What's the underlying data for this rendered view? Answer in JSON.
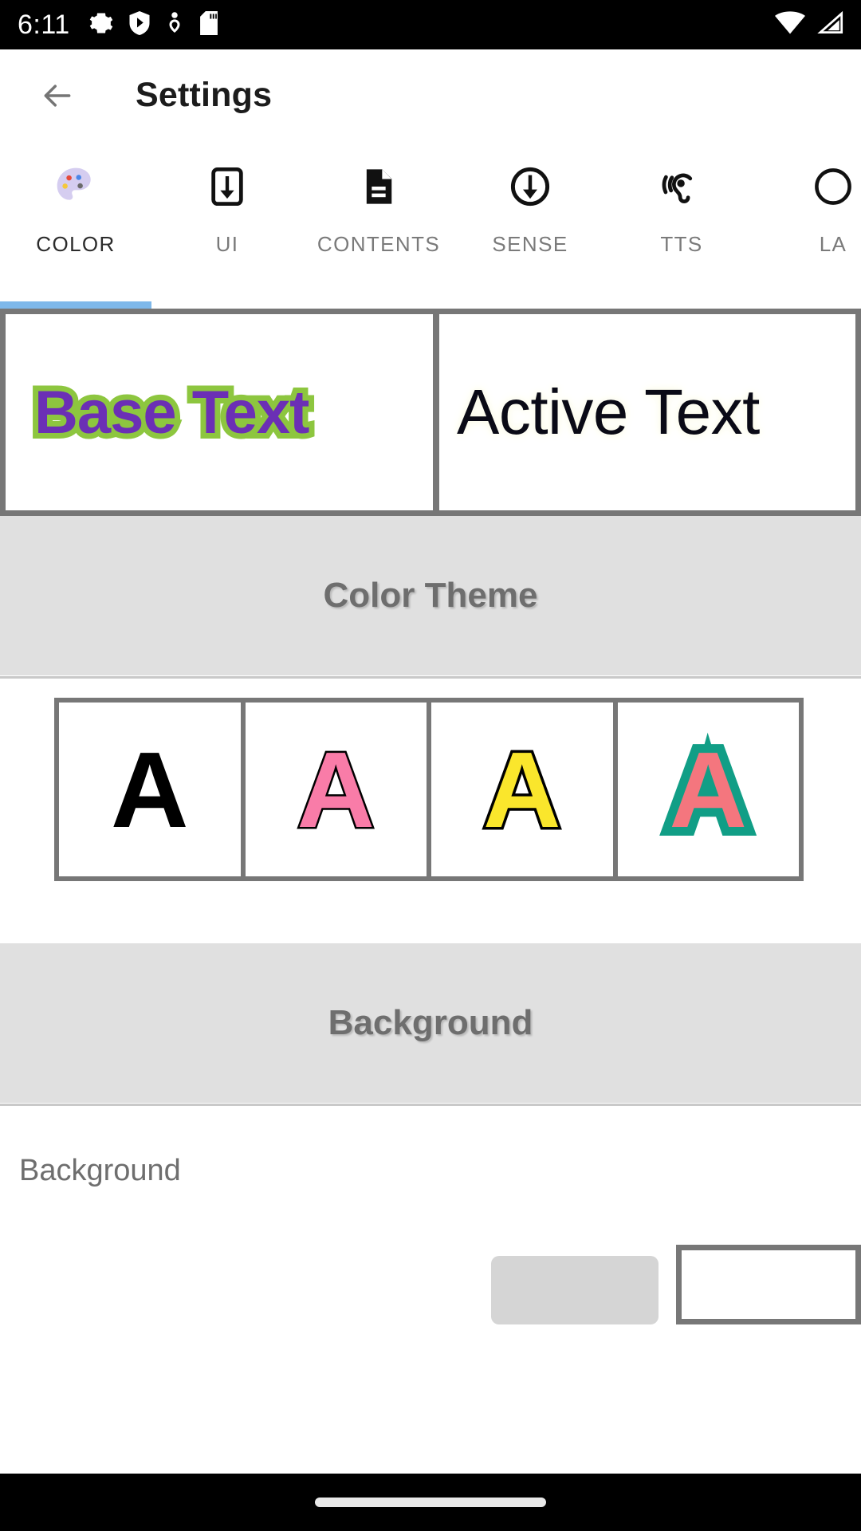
{
  "status_bar": {
    "time": "6:11",
    "left_icons": [
      "gear-icon",
      "shield-play-icon",
      "heart-pulse-icon",
      "sd-card-icon"
    ],
    "right_icons": [
      "wifi-icon",
      "cell-signal-icon"
    ]
  },
  "app_bar": {
    "back_icon": "back-arrow-icon",
    "title": "Settings"
  },
  "tabs": [
    {
      "label": "COLOR",
      "icon": "palette-icon",
      "active": true
    },
    {
      "label": "UI",
      "icon": "download-box-icon",
      "active": false
    },
    {
      "label": "CONTENTS",
      "icon": "document-icon",
      "active": false
    },
    {
      "label": "SENSE",
      "icon": "download-circle-icon",
      "active": false
    },
    {
      "label": "TTS",
      "icon": "ear-hearing-icon",
      "active": false
    },
    {
      "label": "LA",
      "icon": "language-icon",
      "active": false
    }
  ],
  "preview": {
    "base_text": "Base Text",
    "base_text_color": "#6B2FB5",
    "base_text_outline_color": "#8DC63F",
    "active_text": "Active Text",
    "active_text_color": "#0A0A16",
    "active_text_glow_color": "#FBFBE8"
  },
  "color_theme": {
    "section_title": "Color Theme",
    "swatches": [
      {
        "letter": "A",
        "fill": "#000000",
        "outline": "#000000"
      },
      {
        "letter": "A",
        "fill": "#F97CA8",
        "outline": "#000000"
      },
      {
        "letter": "A",
        "fill": "#FAE62C",
        "outline": "#000000"
      },
      {
        "letter": "A",
        "fill": "#F4767E",
        "outline": "#119E86"
      }
    ]
  },
  "background": {
    "section_title": "Background",
    "row_label": "Background"
  },
  "theme": {
    "accent": "#7EB8EA",
    "band_bg": "#E0E0E0",
    "border_gray": "#777777",
    "muted_text": "#6E6E6E"
  }
}
